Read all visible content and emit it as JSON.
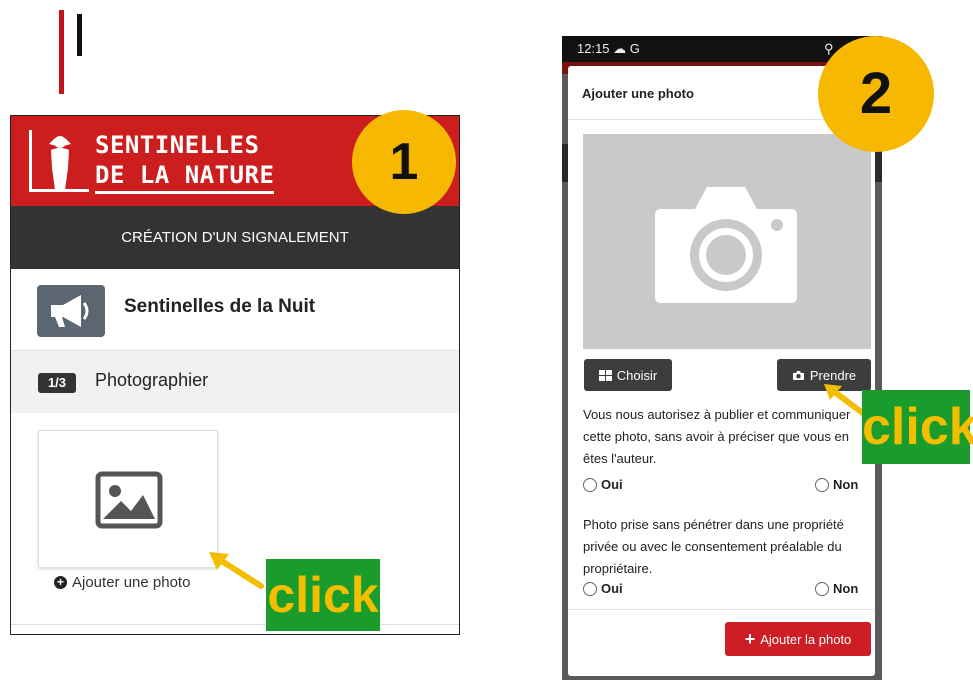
{
  "colors": {
    "brand_red": "#cc1e1e",
    "badge_yellow": "#f6b800",
    "click_green": "#1a9c2c",
    "click_text": "#f3be00",
    "dark_bar": "#333333"
  },
  "panel1": {
    "badge_number": "1",
    "brand_line1": "SENTINELLES",
    "brand_line2": "DE LA NATURE",
    "subheader": "CRÉATION D'UN SIGNALEMENT",
    "project_icon": "megaphone-icon",
    "project_title": "Sentinelles de la Nuit",
    "step_badge": "1/3",
    "step_label": "Photographier",
    "photo_placeholder_icon": "image-icon",
    "add_photo_label": "Ajouter une photo",
    "click_label": "click"
  },
  "panel2": {
    "badge_number": "2",
    "status_time": "12:15",
    "status_extra": "G",
    "modal_title": "Ajouter une photo",
    "camera_icon": "camera-icon",
    "choose_label": "Choisir",
    "take_label": "Prendre",
    "question1": "Vous nous autorisez à publier et communiquer cette photo, sans avoir à préciser que vous en êtes l'auteur.",
    "question2": "Photo prise sans pénétrer dans une propriété privée ou avec le consentement préalable du propriétaire.",
    "yes_label": "Oui",
    "no_label": "Non",
    "add_button_label": "Ajouter la photo",
    "click_label": "click"
  }
}
